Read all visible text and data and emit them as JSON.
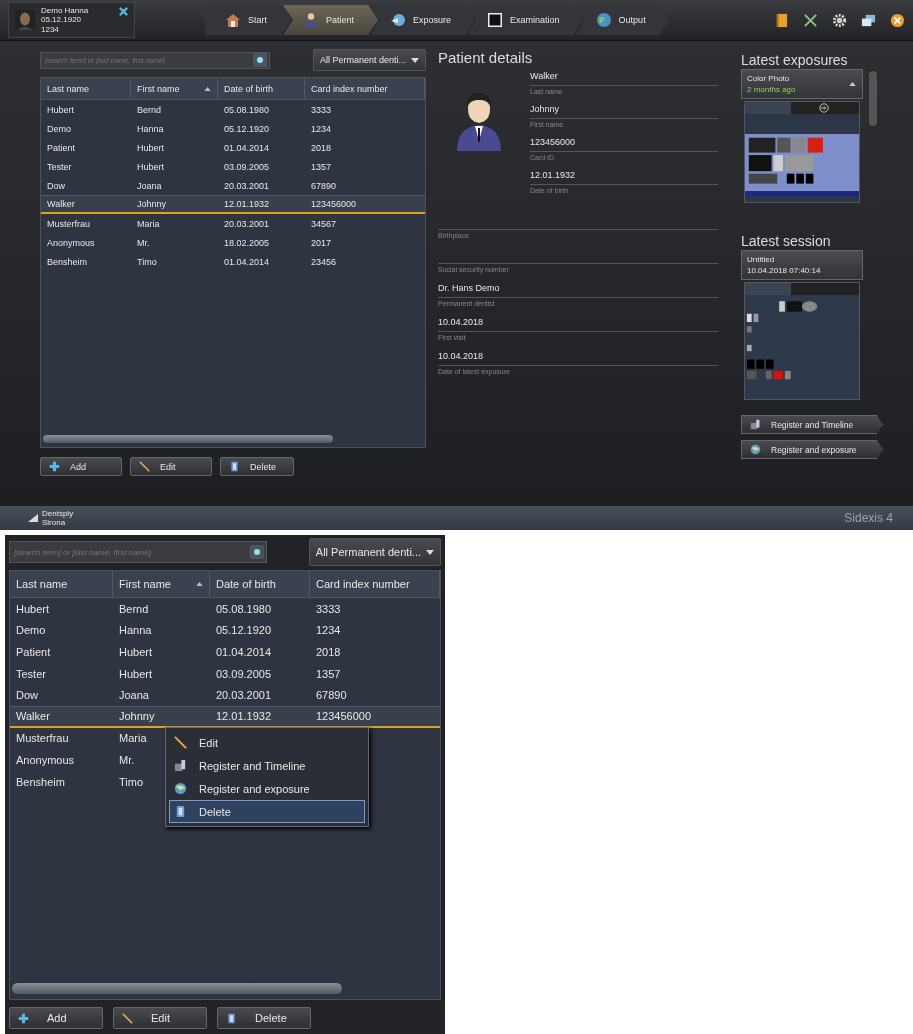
{
  "top_bar": {
    "patient": {
      "name": "Demo Hanna",
      "birth": "05.12.1920",
      "id": "1234"
    },
    "nav": [
      {
        "label": "Start",
        "kind": "home",
        "selected": false
      },
      {
        "label": "Patient",
        "kind": "patient",
        "selected": true
      },
      {
        "label": "Exposure",
        "kind": "exposure",
        "selected": false
      },
      {
        "label": "Examination",
        "kind": "examination",
        "selected": false
      },
      {
        "label": "Output",
        "kind": "output",
        "selected": false
      }
    ]
  },
  "patient_list": {
    "search": {
      "placeholder": "[search term] or [last name, first name]"
    },
    "filter": "All Permanent denti...",
    "columns": [
      {
        "label": "Last name",
        "sorted": false
      },
      {
        "label": "First name",
        "sorted": true
      },
      {
        "label": "Date of birth",
        "sorted": false
      },
      {
        "label": "Card index number",
        "sorted": false
      }
    ],
    "rows": [
      {
        "cells": [
          "Hubert",
          "Bernd",
          "05.08.1980",
          "3333"
        ],
        "selected": false
      },
      {
        "cells": [
          "Demo",
          "Hanna",
          "05.12.1920",
          "1234"
        ],
        "selected": false
      },
      {
        "cells": [
          "Patient",
          "Hubert",
          "01.04.2014",
          "2018"
        ],
        "selected": false
      },
      {
        "cells": [
          "Tester",
          "Hubert",
          "03.09.2005",
          "1357"
        ],
        "selected": false
      },
      {
        "cells": [
          "Dow",
          "Joana",
          "20.03.2001",
          "67890"
        ],
        "selected": false
      },
      {
        "cells": [
          "Walker",
          "Johnny",
          "12.01.1932",
          "123456000"
        ],
        "selected": true
      },
      {
        "cells": [
          "Musterfrau",
          "Maria",
          "20.03.2001",
          "34567"
        ],
        "selected": false
      },
      {
        "cells": [
          "Anonymous",
          "Mr.",
          "18.02.2005",
          "2017"
        ],
        "selected": false
      },
      {
        "cells": [
          "Bensheim",
          "Timo",
          "01.04.2014",
          "23456"
        ],
        "selected": false
      }
    ],
    "buttons": [
      {
        "label": "Add",
        "kind": "add"
      },
      {
        "label": "Edit",
        "kind": "edit"
      },
      {
        "label": "Delete",
        "kind": "delete"
      }
    ]
  },
  "details": {
    "title": "Patient details",
    "fields": [
      {
        "value": "Walker",
        "label": "Last name"
      },
      {
        "value": "Johnny",
        "label": "First name"
      },
      {
        "value": "123456000",
        "label": "Card ID"
      },
      {
        "value": "12.01.1932",
        "label": "Date of birth"
      }
    ],
    "more_fields": [
      {
        "label": "Birthplace"
      },
      {
        "label": "Social security number"
      },
      {
        "value": "Dr. Hans Demo",
        "label": "Permanent dentist"
      },
      {
        "value": "10.04.2018",
        "label": "First visit"
      },
      {
        "value": "10.04.2018",
        "label": "Date of latest exposure"
      }
    ]
  },
  "latest_exposures": {
    "title": "Latest exposures",
    "name": "Color Photo",
    "age": "2 months ago"
  },
  "latest_session": {
    "title": "Latest session",
    "name": "Untitled",
    "date": "10.04.2018 07:40:14"
  },
  "actions": [
    {
      "label": "Register and Timeline",
      "kind": "timeline"
    },
    {
      "label": "Register and exposure",
      "kind": "exposure"
    }
  ],
  "footer": {
    "logo": "Dentsply Sirona",
    "product": "Sidexis 4"
  },
  "zoomed_list": {
    "search": {
      "placeholder": "[search term] or [last name, first name]"
    },
    "filter": "All Permanent denti...",
    "columns": [
      {
        "label": "Last name",
        "sorted": false
      },
      {
        "label": "First name",
        "sorted": true
      },
      {
        "label": "Date of birth",
        "sorted": false
      },
      {
        "label": "Card index number",
        "sorted": false
      }
    ],
    "rows": [
      {
        "cells": [
          "Hubert",
          "Bernd",
          "05.08.1980",
          "3333"
        ],
        "selected": false
      },
      {
        "cells": [
          "Demo",
          "Hanna",
          "05.12.1920",
          "1234"
        ],
        "selected": false
      },
      {
        "cells": [
          "Patient",
          "Hubert",
          "01.04.2014",
          "2018"
        ],
        "selected": false
      },
      {
        "cells": [
          "Tester",
          "Hubert",
          "03.09.2005",
          "1357"
        ],
        "selected": false
      },
      {
        "cells": [
          "Dow",
          "Joana",
          "20.03.2001",
          "67890"
        ],
        "selected": false
      },
      {
        "cells": [
          "Walker",
          "Johnny",
          "12.01.1932",
          "123456000"
        ],
        "selected": true
      },
      {
        "cells": [
          "Musterfrau",
          "Maria"
        ],
        "selected": false
      },
      {
        "cells": [
          "Anonymous",
          "Mr."
        ],
        "selected": false
      },
      {
        "cells": [
          "Bensheim",
          "Timo"
        ],
        "selected": false
      }
    ],
    "context_menu": [
      {
        "label": "Edit",
        "kind": "edit",
        "selected": false
      },
      {
        "label": "Register and Timeline",
        "kind": "timeline",
        "selected": false
      },
      {
        "label": "Register and exposure",
        "kind": "exposure",
        "selected": false
      },
      {
        "label": "Delete",
        "kind": "delete",
        "selected": true
      }
    ],
    "buttons": [
      {
        "label": "Add",
        "kind": "add"
      },
      {
        "label": "Edit",
        "kind": "edit"
      },
      {
        "label": "Delete",
        "kind": "delete"
      }
    ]
  }
}
